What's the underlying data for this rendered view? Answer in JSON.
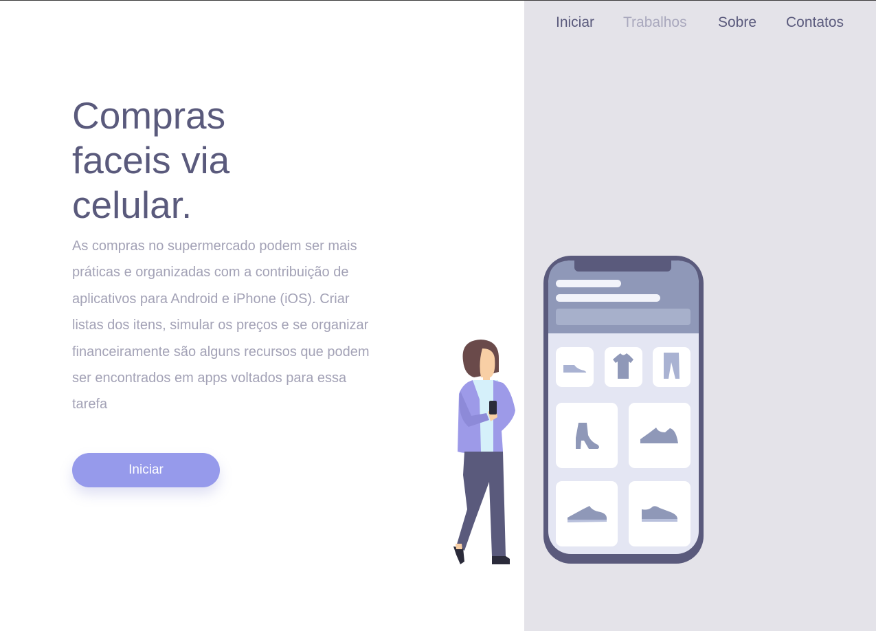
{
  "nav": {
    "items": [
      {
        "label": "Iniciar"
      },
      {
        "label": "Trabalhos"
      },
      {
        "label": "Sobre"
      },
      {
        "label": "Contatos"
      }
    ]
  },
  "hero": {
    "title": "Compras faceis via celular.",
    "description": "As compras no supermercado podem ser mais práticas e organizadas com a contribuição de aplicativos para Android e iPhone (iOS). Criar listas dos itens, simular os preços e se organizar financeiramente são alguns recursos que podem ser encontrados em apps voltados para essa tarefa",
    "button_label": "Iniciar"
  },
  "colors": {
    "heading": "#5a5a7c",
    "body_text": "#a3a2b6",
    "accent": "#969aeb",
    "panel_bg": "#e4e3e9",
    "nav_inactive": "#a9a8bd"
  },
  "illustration": {
    "icons": [
      "flat-shoe-icon",
      "tshirt-icon",
      "pants-icon",
      "high-heel-boot-icon",
      "sneaker-icon",
      "running-shoe-icon",
      "low-sneaker-icon"
    ]
  }
}
